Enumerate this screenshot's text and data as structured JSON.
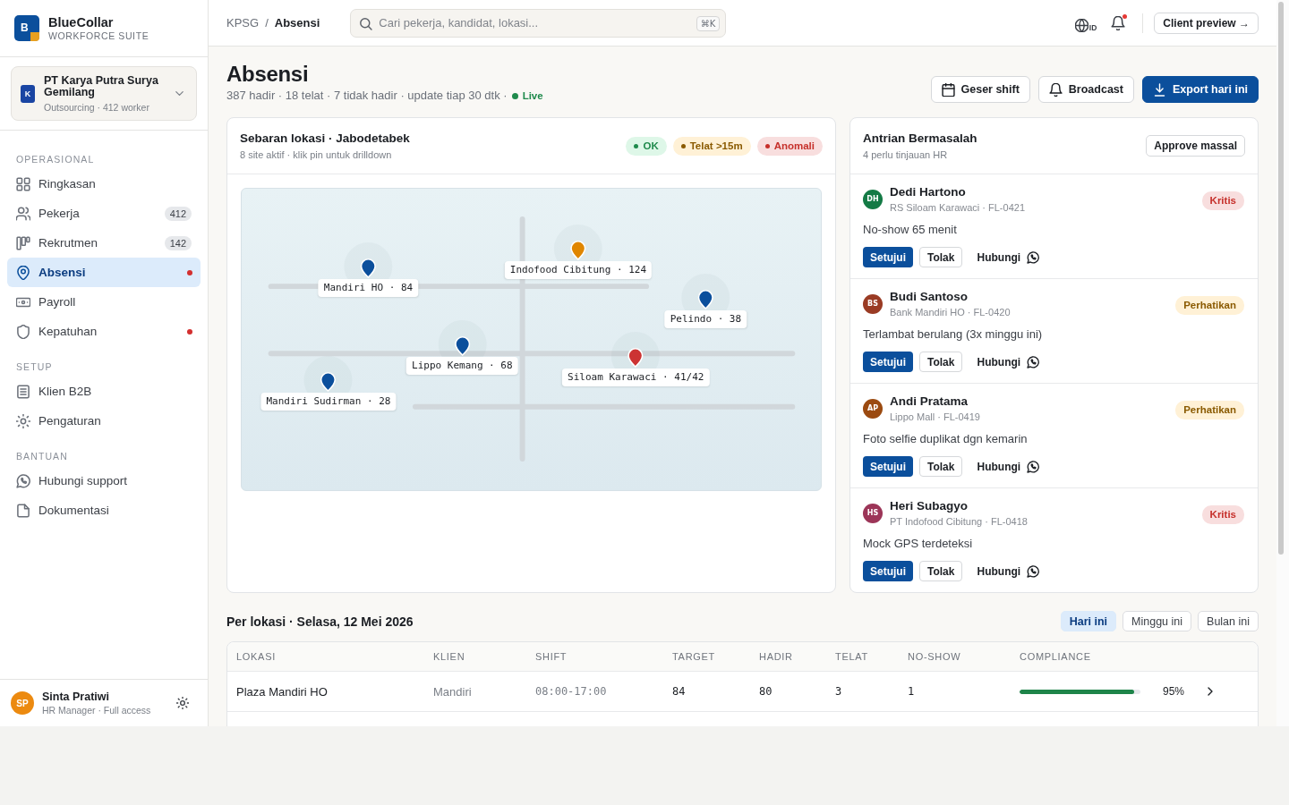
{
  "sidebar": {
    "brand": {
      "logo_letter": "B",
      "name": "BlueCollar",
      "tagline": "WORKFORCE SUITE"
    },
    "org": {
      "initial": "K",
      "name": "PT Karya Putra Surya Gemilang",
      "meta": "Outsourcing · 412 worker"
    },
    "sections": [
      {
        "title": "OPERASIONAL",
        "items": [
          {
            "label": "Ringkasan",
            "alert": false,
            "selected": false
          },
          {
            "label": "Pekerja",
            "count": "412",
            "alert": false,
            "selected": false
          },
          {
            "label": "Rekrutmen",
            "count": "142",
            "alert": false,
            "selected": false
          },
          {
            "label": "Absensi",
            "alert": true,
            "selected": true
          },
          {
            "label": "Payroll",
            "alert": false,
            "selected": false
          },
          {
            "label": "Kepatuhan",
            "alert": true,
            "selected": false
          }
        ]
      },
      {
        "title": "SETUP",
        "items": [
          {
            "label": "Klien B2B",
            "alert": false,
            "selected": false
          },
          {
            "label": "Pengaturan",
            "alert": false,
            "selected": false
          }
        ]
      },
      {
        "title": "BANTUAN",
        "items": [
          {
            "label": "Hubungi support",
            "alert": false,
            "selected": false
          },
          {
            "label": "Dokumentasi",
            "alert": false,
            "selected": false
          }
        ]
      }
    ],
    "user": {
      "initials": "SP",
      "name": "Sinta Pratiwi",
      "role": "HR Manager · Full access"
    }
  },
  "topbar": {
    "breadcrumb": {
      "items": [
        "KPSG",
        "Absensi"
      ],
      "separator": "/"
    },
    "search": {
      "placeholder": "Cari pekerja, kandidat, lokasi...",
      "shortcut": "⌘K"
    },
    "language": "ID",
    "notifications_unread": true,
    "client_preview": "Client preview →"
  },
  "page": {
    "title": "Absensi",
    "summary": "387 hadir · 18 telat · 7 tidak hadir · update tiap 30 dtk ·",
    "live": {
      "on": true,
      "label": "Live"
    },
    "actions": [
      {
        "label": "Geser shift",
        "kind": "secondary"
      },
      {
        "label": "Broadcast",
        "kind": "secondary"
      },
      {
        "label": "Export hari ini",
        "kind": "primary"
      }
    ]
  },
  "map": {
    "title": "Sebaran lokasi · Jabodetabek",
    "subtitle": "8 site aktif · klik pin untuk drilldown",
    "legend": [
      {
        "label": "OK",
        "color": "#1f8a4c"
      },
      {
        "label": "Telat >15m",
        "color": "#8a5a00"
      },
      {
        "label": "Anomali",
        "color": "#c6302b"
      }
    ],
    "pins": [
      {
        "label": "Indofood Cibitung · 124",
        "color": "#e08600"
      },
      {
        "label": "Mandiri HO · 84",
        "color": "#0b4f9c"
      },
      {
        "label": "Pelindo · 38",
        "color": "#0b4f9c"
      },
      {
        "label": "Lippo Kemang · 68",
        "color": "#0b4f9c"
      },
      {
        "label": "Siloam Karawaci · 41/42",
        "color": "#cc3333"
      },
      {
        "label": "Mandiri Sudirman · 28",
        "color": "#0b4f9c"
      }
    ]
  },
  "queue": {
    "title": "Antrian Bermasalah",
    "subtitle": "4 perlu tinjauan HR",
    "bulk_action": "Approve massal",
    "items": [
      {
        "initials": "DH",
        "color": "#147a45",
        "name": "Dedi Hartono",
        "meta": "RS Siloam Karawaci · FL-0421",
        "badge": {
          "label": "Kritis",
          "color": "#c6302b"
        },
        "message": "No-show 65 menit",
        "approve": "Setujui",
        "reject": "Tolak",
        "contact": "Hubungi"
      },
      {
        "initials": "BS",
        "color": "#9a3b24",
        "name": "Budi Santoso",
        "meta": "Bank Mandiri HO · FL-0420",
        "badge": {
          "label": "Perhatikan",
          "color": "#8a5a00"
        },
        "message": "Terlambat berulang (3x minggu ini)",
        "approve": "Setujui",
        "reject": "Tolak",
        "contact": "Hubungi"
      },
      {
        "initials": "AP",
        "color": "#9b4a10",
        "name": "Andi Pratama",
        "meta": "Lippo Mall · FL-0419",
        "badge": {
          "label": "Perhatikan",
          "color": "#8a5a00"
        },
        "message": "Foto selfie duplikat dgn kemarin",
        "approve": "Setujui",
        "reject": "Tolak",
        "contact": "Hubungi"
      },
      {
        "initials": "HS",
        "color": "#9c3558",
        "name": "Heri Subagyo",
        "meta": "PT Indofood Cibitung · FL-0418",
        "badge": {
          "label": "Kritis",
          "color": "#c6302b"
        },
        "message": "Mock GPS terdeteksi",
        "approve": "Setujui",
        "reject": "Tolak",
        "contact": "Hubungi"
      }
    ]
  },
  "per_location": {
    "title": "Per lokasi · Selasa, 12 Mei 2026",
    "ranges": [
      {
        "label": "Hari ini",
        "selected": true
      },
      {
        "label": "Minggu ini",
        "selected": false
      },
      {
        "label": "Bulan ini",
        "selected": false
      }
    ],
    "table": {
      "columns": [
        "LOKASI",
        "KLIEN",
        "SHIFT",
        "TARGET",
        "HADIR",
        "TELAT",
        "NO-SHOW",
        "COMPLIANCE"
      ],
      "rows": [
        {
          "location": "Plaza Mandiri HO",
          "client": "Mandiri",
          "shift": "08:00-17:00",
          "target": "84",
          "present": "80",
          "late": "3",
          "no_show": "1",
          "compliance": {
            "level": 0.95,
            "reading": "95%"
          }
        }
      ]
    }
  }
}
